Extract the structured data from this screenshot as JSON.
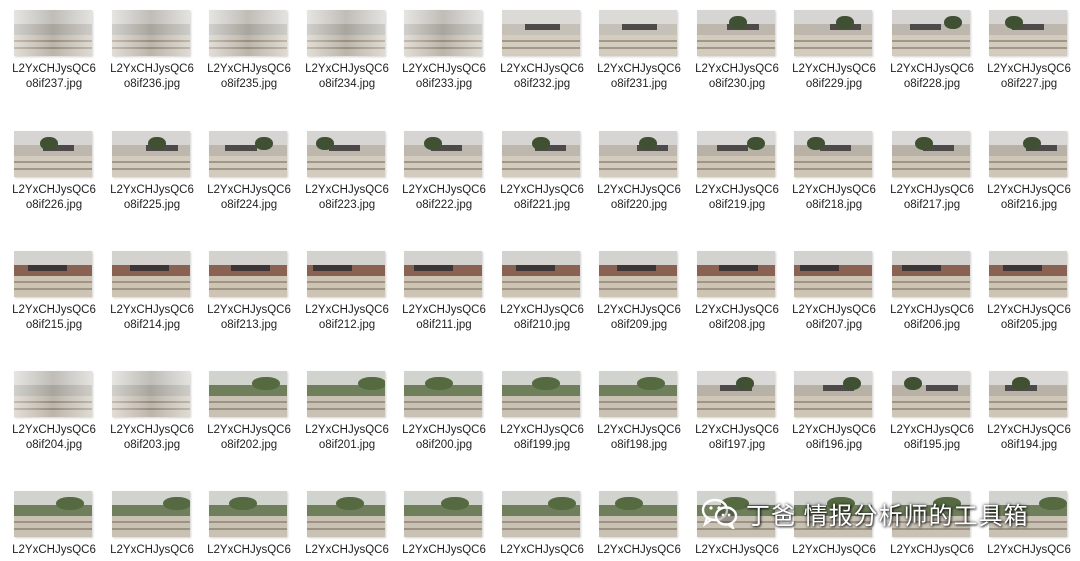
{
  "files": [
    {
      "line1": "L2YxCHJysQC6",
      "line2": "o8if237.jpg",
      "scene": "blur"
    },
    {
      "line1": "L2YxCHJysQC6",
      "line2": "o8if236.jpg",
      "scene": "blur"
    },
    {
      "line1": "L2YxCHJysQC6",
      "line2": "o8if235.jpg",
      "scene": "blur"
    },
    {
      "line1": "L2YxCHJysQC6",
      "line2": "o8if234.jpg",
      "scene": "blur"
    },
    {
      "line1": "L2YxCHJysQC6",
      "line2": "o8if233.jpg",
      "scene": "blur"
    },
    {
      "line1": "L2YxCHJysQC6",
      "line2": "o8if232.jpg",
      "scene": "plain"
    },
    {
      "line1": "L2YxCHJysQC6",
      "line2": "o8if231.jpg",
      "scene": "plain"
    },
    {
      "line1": "L2YxCHJysQC6",
      "line2": "o8if230.jpg",
      "scene": "tree"
    },
    {
      "line1": "L2YxCHJysQC6",
      "line2": "o8if229.jpg",
      "scene": "tree"
    },
    {
      "line1": "L2YxCHJysQC6",
      "line2": "o8if228.jpg",
      "scene": "tree"
    },
    {
      "line1": "L2YxCHJysQC6",
      "line2": "o8if227.jpg",
      "scene": "tree"
    },
    {
      "line1": "L2YxCHJysQC6",
      "line2": "o8if226.jpg",
      "scene": "tree"
    },
    {
      "line1": "L2YxCHJysQC6",
      "line2": "o8if225.jpg",
      "scene": "tree"
    },
    {
      "line1": "L2YxCHJysQC6",
      "line2": "o8if224.jpg",
      "scene": "tree"
    },
    {
      "line1": "L2YxCHJysQC6",
      "line2": "o8if223.jpg",
      "scene": "tree"
    },
    {
      "line1": "L2YxCHJysQC6",
      "line2": "o8if222.jpg",
      "scene": "tree"
    },
    {
      "line1": "L2YxCHJysQC6",
      "line2": "o8if221.jpg",
      "scene": "tree"
    },
    {
      "line1": "L2YxCHJysQC6",
      "line2": "o8if220.jpg",
      "scene": "tree"
    },
    {
      "line1": "L2YxCHJysQC6",
      "line2": "o8if219.jpg",
      "scene": "house"
    },
    {
      "line1": "L2YxCHJysQC6",
      "line2": "o8if218.jpg",
      "scene": "house"
    },
    {
      "line1": "L2YxCHJysQC6",
      "line2": "o8if217.jpg",
      "scene": "house"
    },
    {
      "line1": "L2YxCHJysQC6",
      "line2": "o8if216.jpg",
      "scene": "house"
    },
    {
      "line1": "L2YxCHJysQC6",
      "line2": "o8if215.jpg",
      "scene": "brick"
    },
    {
      "line1": "L2YxCHJysQC6",
      "line2": "o8if214.jpg",
      "scene": "brick"
    },
    {
      "line1": "L2YxCHJysQC6",
      "line2": "o8if213.jpg",
      "scene": "brick"
    },
    {
      "line1": "L2YxCHJysQC6",
      "line2": "o8if212.jpg",
      "scene": "brick"
    },
    {
      "line1": "L2YxCHJysQC6",
      "line2": "o8if211.jpg",
      "scene": "brick"
    },
    {
      "line1": "L2YxCHJysQC6",
      "line2": "o8if210.jpg",
      "scene": "brick"
    },
    {
      "line1": "L2YxCHJysQC6",
      "line2": "o8if209.jpg",
      "scene": "brick"
    },
    {
      "line1": "L2YxCHJysQC6",
      "line2": "o8if208.jpg",
      "scene": "brick"
    },
    {
      "line1": "L2YxCHJysQC6",
      "line2": "o8if207.jpg",
      "scene": "brick"
    },
    {
      "line1": "L2YxCHJysQC6",
      "line2": "o8if206.jpg",
      "scene": "brick"
    },
    {
      "line1": "L2YxCHJysQC6",
      "line2": "o8if205.jpg",
      "scene": "brick"
    },
    {
      "line1": "L2YxCHJysQC6",
      "line2": "o8if204.jpg",
      "scene": "blur"
    },
    {
      "line1": "L2YxCHJysQC6",
      "line2": "o8if203.jpg",
      "scene": "blur"
    },
    {
      "line1": "L2YxCHJysQC6",
      "line2": "o8if202.jpg",
      "scene": "green"
    },
    {
      "line1": "L2YxCHJysQC6",
      "line2": "o8if201.jpg",
      "scene": "green"
    },
    {
      "line1": "L2YxCHJysQC6",
      "line2": "o8if200.jpg",
      "scene": "green"
    },
    {
      "line1": "L2YxCHJysQC6",
      "line2": "o8if199.jpg",
      "scene": "green"
    },
    {
      "line1": "L2YxCHJysQC6",
      "line2": "o8if198.jpg",
      "scene": "green"
    },
    {
      "line1": "L2YxCHJysQC6",
      "line2": "o8if197.jpg",
      "scene": "house"
    },
    {
      "line1": "L2YxCHJysQC6",
      "line2": "o8if196.jpg",
      "scene": "house"
    },
    {
      "line1": "L2YxCHJysQC6",
      "line2": "o8if195.jpg",
      "scene": "house"
    },
    {
      "line1": "L2YxCHJysQC6",
      "line2": "o8if194.jpg",
      "scene": "house"
    },
    {
      "line1": "L2YxCHJysQC6",
      "line2": "",
      "scene": "green"
    },
    {
      "line1": "L2YxCHJysQC6",
      "line2": "",
      "scene": "green"
    },
    {
      "line1": "L2YxCHJysQC6",
      "line2": "",
      "scene": "green"
    },
    {
      "line1": "L2YxCHJysQC6",
      "line2": "",
      "scene": "green"
    },
    {
      "line1": "L2YxCHJysQC6",
      "line2": "",
      "scene": "green"
    },
    {
      "line1": "L2YxCHJysQC6",
      "line2": "",
      "scene": "green"
    },
    {
      "line1": "L2YxCHJysQC6",
      "line2": "",
      "scene": "green"
    },
    {
      "line1": "L2YxCHJysQC6",
      "line2": "",
      "scene": "green"
    },
    {
      "line1": "L2YxCHJysQC6",
      "line2": "",
      "scene": "green"
    },
    {
      "line1": "L2YxCHJysQC6",
      "line2": "",
      "scene": "green"
    },
    {
      "line1": "L2YxCHJysQC6",
      "line2": "",
      "scene": "green"
    }
  ],
  "watermark": {
    "text": "丁爸 情报分析师的工具箱",
    "icon": "wechat-icon"
  },
  "colors": {
    "background": "#ffffff",
    "filename_text": "#222222",
    "watermark_text": "#ffffff"
  }
}
